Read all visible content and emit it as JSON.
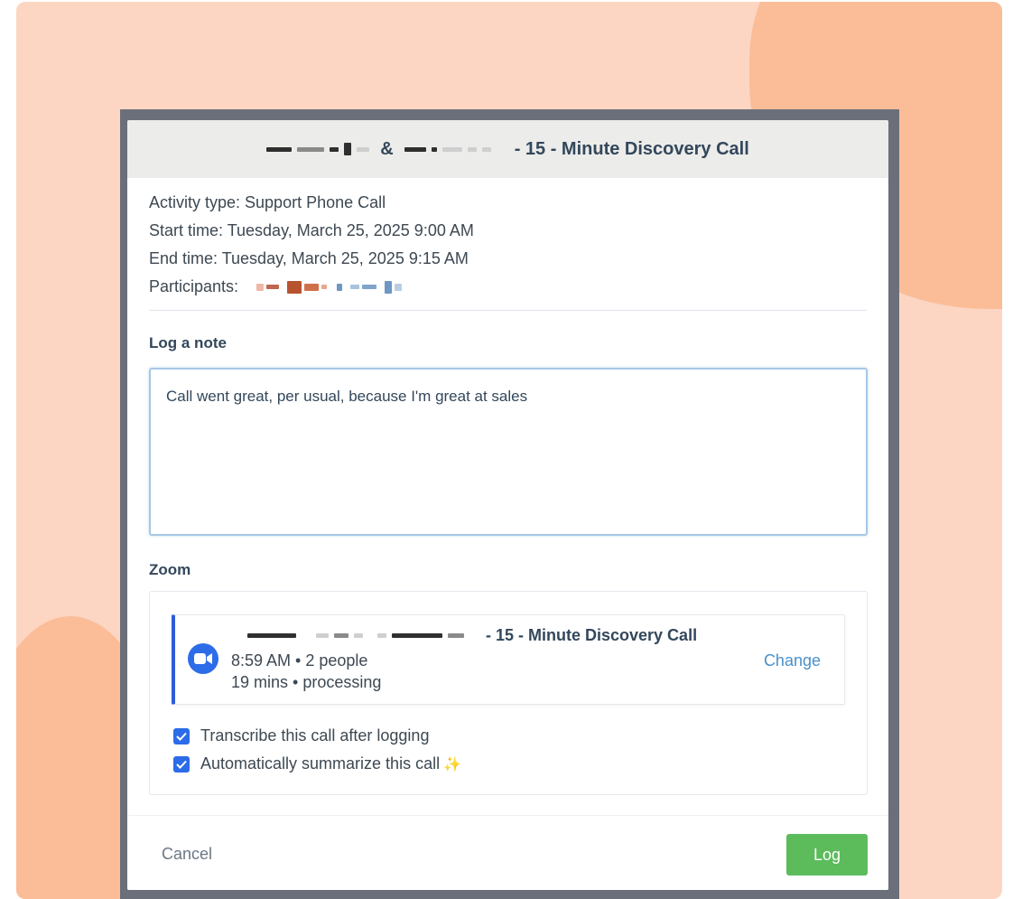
{
  "modal": {
    "title_separator": "&",
    "title_suffix": "- 15 - Minute Discovery Call"
  },
  "details": {
    "activity_type": "Activity type: Support Phone Call",
    "start_time": "Start time: Tuesday, March 25, 2025 9:00 AM",
    "end_time": "End time: Tuesday, March 25, 2025 9:15 AM",
    "participants_label": "Participants:"
  },
  "note": {
    "label": "Log a note",
    "value": "Call went great, per usual, because I'm great at sales"
  },
  "zoom": {
    "label": "Zoom",
    "meeting": {
      "title_suffix": "- 15 - Minute Discovery Call",
      "time_people": "8:59 AM • 2 people",
      "duration_status": "19 mins • processing",
      "change_label": "Change"
    },
    "options": [
      {
        "label": "Transcribe this call after logging",
        "checked": true
      },
      {
        "label": "Automatically summarize this call",
        "checked": true,
        "icon": "sparkles-icon"
      }
    ]
  },
  "footer": {
    "cancel_label": "Cancel",
    "log_label": "Log"
  },
  "colors": {
    "primary": "#2d6ce8",
    "log_button": "#5cbc5c",
    "link": "#4a90c9",
    "backdrop": "#fcd6c3"
  }
}
